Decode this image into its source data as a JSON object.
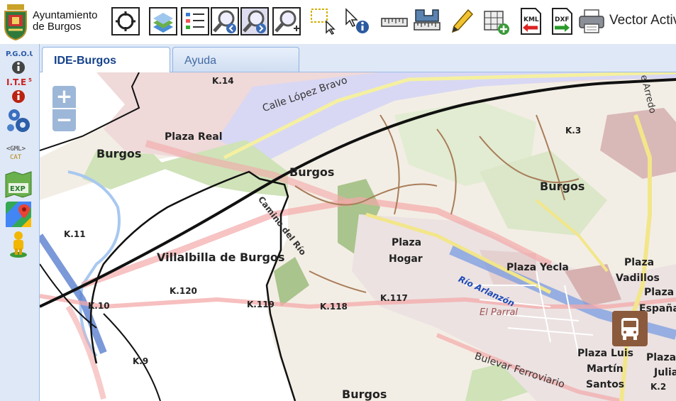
{
  "brand": {
    "line1": "Ayuntamiento",
    "line2": "de Burgos"
  },
  "toolbar": {
    "vector_label": "Vector Activ",
    "buttons": [
      "pan-target-tool",
      "layers-tool",
      "legend-tool",
      "zoom-previous-tool",
      "zoom-next-tool",
      "zoom-box-tool",
      "select-rectangle-tool",
      "info-pointer-tool",
      "measure-distance-tool",
      "measure-area-tool",
      "edit-pencil-tool",
      "add-grid-tool",
      "export-kml-tool",
      "export-dxf-tool",
      "print-tool"
    ],
    "kml_text": "KML",
    "dxf_text": "DXF"
  },
  "sidebar": {
    "pgou_text": "P.G.O.U",
    "ite_text": "I.T.E",
    "ite_sup": "5",
    "gml_line1": "<GML>",
    "gml_line2": "CAT",
    "exp_text": "EXP"
  },
  "tabs": [
    {
      "label": "IDE-Burgos",
      "active": true
    },
    {
      "label": "Ayuda",
      "active": false
    }
  ],
  "map": {
    "zoom_in": "+",
    "zoom_out": "−",
    "labels": {
      "k14": "K.14",
      "calle_lopez": "Calle López Bravo",
      "plaza_real": "Plaza Real",
      "burgos_1": "Burgos",
      "burgos_2": "Burgos",
      "burgos_3": "Burgos",
      "burgos_4": "Burgos",
      "k3": "K.3",
      "camino_rio": "Camino del Río",
      "k11": "K.11",
      "villalbilla": "Villalbilla de Burgos",
      "plaza_hogar_1": "Plaza",
      "plaza_hogar_2": "Hogar",
      "plaza_yecla": "Plaza Yecla",
      "plaza_vadillos_1": "Plaza",
      "plaza_vadillos_2": "Vadillos",
      "plaza_espana_1": "Plaza",
      "plaza_espana_2": "España",
      "rio_arlanzon": "Río Arlanzón",
      "el_parral": "El Parral",
      "k120": "K.120",
      "k10": "K.10",
      "k119": "K.119",
      "k118": "K.118",
      "k117": "K.117",
      "k9": "K.9",
      "bulevar": "Bulevar Ferroviario",
      "plaza_luis_1": "Plaza Luis",
      "plaza_luis_2": "Martín",
      "plaza_luis_3": "Santos",
      "plaza_julia_1": "Plaza",
      "plaza_julia_2": "Julia",
      "k2": "K.2",
      "arredo": "e Arredo"
    }
  }
}
